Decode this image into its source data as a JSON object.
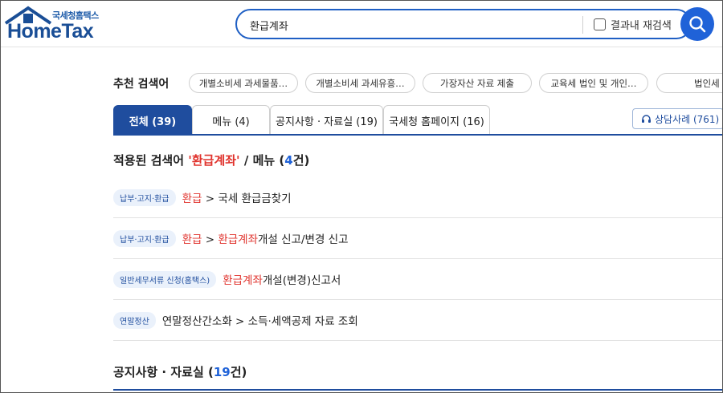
{
  "header": {
    "logo_sub": "국세청홈택스",
    "logo_main": "HomeTax",
    "search_value": "환급계좌",
    "recheck_label": "결과내 재검색"
  },
  "recommended": {
    "title": "추천 검색어",
    "chips": [
      "개별소비세 과세물품…",
      "개별소비세 과세유흥…",
      "가장자산 자료 제출",
      "교육세 법인 및 개인…",
      "법인세 신"
    ]
  },
  "tabs": [
    {
      "label": "전체 (39)",
      "active": true
    },
    {
      "label": "메뉴 (4)",
      "active": false
    },
    {
      "label": "공지사항 · 자료실 (19)",
      "active": false
    },
    {
      "label": "국세청 홈페이지 (16)",
      "active": false
    }
  ],
  "consult": {
    "label": "상담사례 (761)",
    "icon": "headset-icon"
  },
  "menu_section": {
    "prefix": "적용된 검색어 ",
    "keyword": "'환급계좌'",
    "middle": " / 메뉴 (",
    "count": "4",
    "suffix": "건)"
  },
  "results": [
    {
      "badge": "납부·고지·환급",
      "parts": [
        {
          "t": "환급",
          "hl": true
        },
        {
          "t": " > ",
          "hl": false
        },
        {
          "t": "국세 환급금찾기",
          "hl": false
        }
      ]
    },
    {
      "badge": "납부·고지·환급",
      "parts": [
        {
          "t": "환급",
          "hl": true
        },
        {
          "t": " > ",
          "hl": false
        },
        {
          "t": "환급계좌",
          "hl": true
        },
        {
          "t": "개설 신고/변경 신고",
          "hl": false
        }
      ]
    },
    {
      "badge": "일반세무서류 신청(홈택스)",
      "parts": [
        {
          "t": "환급계좌",
          "hl": true
        },
        {
          "t": "개설(변경)신고서",
          "hl": false
        }
      ]
    },
    {
      "badge": "연말정산",
      "parts": [
        {
          "t": "연말정산간소화",
          "hl": false
        },
        {
          "t": " > ",
          "hl": false
        },
        {
          "t": "소득·세액공제 자료 조회",
          "hl": false
        }
      ]
    }
  ],
  "notice_section": {
    "prefix": "공지사항 · 자료실 (",
    "count": "19",
    "suffix": "건)"
  },
  "colors": {
    "primary": "#1f4d9e",
    "accent_blue": "#1f62d8",
    "highlight_red": "#e0322c"
  }
}
